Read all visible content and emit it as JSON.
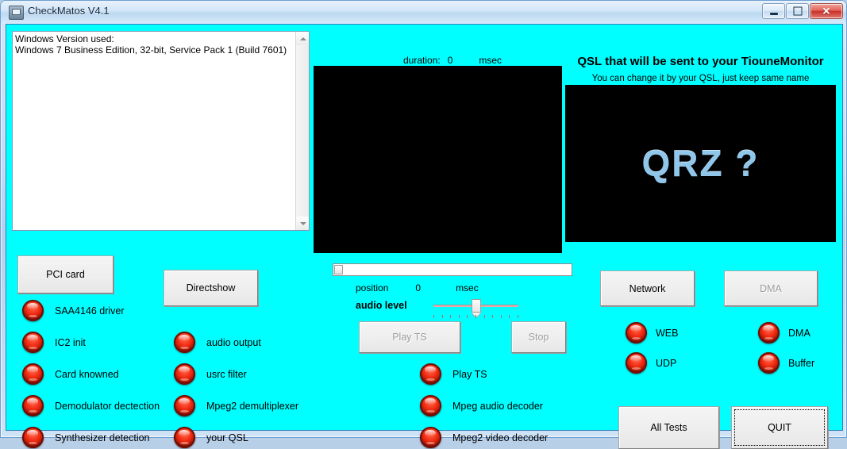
{
  "window": {
    "title": "CheckMatos V4.1",
    "icon": "app-icon",
    "controls": {
      "minimize": "minimize",
      "maximize": "restore",
      "close": "close"
    }
  },
  "log": {
    "text": "Windows Version used:\nWindows 7 Business Edition, 32-bit, Service Pack 1 (Build 7601)"
  },
  "center": {
    "duration_label": "duration:",
    "duration_value": "0",
    "duration_unit": "msec",
    "position_label": "position",
    "position_value": "0",
    "position_unit": "msec",
    "audio_label": "audio level"
  },
  "qsl": {
    "title": "QSL that will be sent to your TiouneMonitor",
    "subtitle": "You can change it by your QSL, just keep same name",
    "image_text": "QRZ ?"
  },
  "buttons": {
    "pci_card": "PCI card",
    "directshow": "Directshow",
    "play_ts": "Play TS",
    "stop": "Stop",
    "network": "Network",
    "dma": "DMA",
    "all_tests": "All Tests",
    "quit": "QUIT"
  },
  "leds": {
    "column1": [
      {
        "label": "SAA4146 driver",
        "state": "red"
      },
      {
        "label": "IC2 init",
        "state": "red"
      },
      {
        "label": "Card knowned",
        "state": "red"
      },
      {
        "label": "Demodulator dectection",
        "state": "red"
      },
      {
        "label": "Synthesizer detection",
        "state": "red"
      }
    ],
    "column2": [
      {
        "label": "audio output",
        "state": "red"
      },
      {
        "label": "usrc filter",
        "state": "red"
      },
      {
        "label": "Mpeg2 demultiplexer",
        "state": "red"
      },
      {
        "label": "your QSL",
        "state": "red"
      }
    ],
    "column3": [
      {
        "label": "Play TS",
        "state": "red"
      },
      {
        "label": "Mpeg audio decoder",
        "state": "red"
      },
      {
        "label": "Mpeg2 video decoder",
        "state": "red"
      }
    ],
    "network": [
      {
        "label": "WEB",
        "state": "red"
      },
      {
        "label": "UDP",
        "state": "red"
      }
    ],
    "dma": [
      {
        "label": "DMA",
        "state": "red"
      },
      {
        "label": "Buffer",
        "state": "red"
      }
    ]
  },
  "colors": {
    "background": "#00ffff",
    "led_red": "#f22d12",
    "panel_black": "#000000",
    "qrz_blue": "#8fc6ea"
  }
}
